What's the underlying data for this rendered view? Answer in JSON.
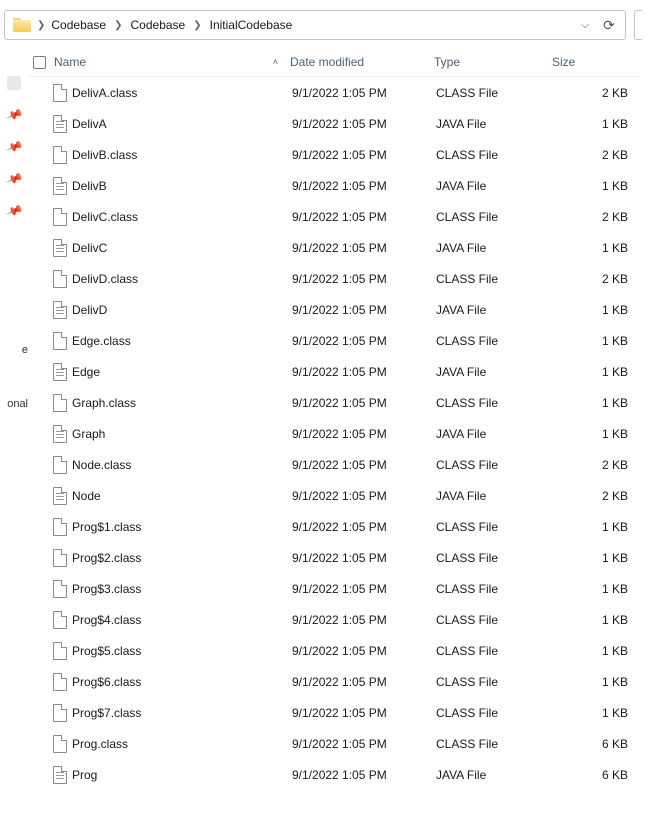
{
  "breadcrumb": {
    "items": [
      "Codebase",
      "Codebase",
      "InitialCodebase"
    ]
  },
  "columns": {
    "name": "Name",
    "date": "Date modified",
    "type": "Type",
    "size": "Size",
    "sort_indicator": "˄"
  },
  "sidebar": {
    "fragments": [
      "e",
      "onal"
    ]
  },
  "files": [
    {
      "name": "DelivA.class",
      "date": "9/1/2022 1:05 PM",
      "type": "CLASS File",
      "size": "2 KB",
      "icon": "plain"
    },
    {
      "name": "DelivA",
      "date": "9/1/2022 1:05 PM",
      "type": "JAVA File",
      "size": "1 KB",
      "icon": "text"
    },
    {
      "name": "DelivB.class",
      "date": "9/1/2022 1:05 PM",
      "type": "CLASS File",
      "size": "2 KB",
      "icon": "plain"
    },
    {
      "name": "DelivB",
      "date": "9/1/2022 1:05 PM",
      "type": "JAVA File",
      "size": "1 KB",
      "icon": "text"
    },
    {
      "name": "DelivC.class",
      "date": "9/1/2022 1:05 PM",
      "type": "CLASS File",
      "size": "2 KB",
      "icon": "plain"
    },
    {
      "name": "DelivC",
      "date": "9/1/2022 1:05 PM",
      "type": "JAVA File",
      "size": "1 KB",
      "icon": "text"
    },
    {
      "name": "DelivD.class",
      "date": "9/1/2022 1:05 PM",
      "type": "CLASS File",
      "size": "2 KB",
      "icon": "plain"
    },
    {
      "name": "DelivD",
      "date": "9/1/2022 1:05 PM",
      "type": "JAVA File",
      "size": "1 KB",
      "icon": "text"
    },
    {
      "name": "Edge.class",
      "date": "9/1/2022 1:05 PM",
      "type": "CLASS File",
      "size": "1 KB",
      "icon": "plain"
    },
    {
      "name": "Edge",
      "date": "9/1/2022 1:05 PM",
      "type": "JAVA File",
      "size": "1 KB",
      "icon": "text"
    },
    {
      "name": "Graph.class",
      "date": "9/1/2022 1:05 PM",
      "type": "CLASS File",
      "size": "1 KB",
      "icon": "plain"
    },
    {
      "name": "Graph",
      "date": "9/1/2022 1:05 PM",
      "type": "JAVA File",
      "size": "1 KB",
      "icon": "text"
    },
    {
      "name": "Node.class",
      "date": "9/1/2022 1:05 PM",
      "type": "CLASS File",
      "size": "2 KB",
      "icon": "plain"
    },
    {
      "name": "Node",
      "date": "9/1/2022 1:05 PM",
      "type": "JAVA File",
      "size": "2 KB",
      "icon": "text"
    },
    {
      "name": "Prog$1.class",
      "date": "9/1/2022 1:05 PM",
      "type": "CLASS File",
      "size": "1 KB",
      "icon": "plain"
    },
    {
      "name": "Prog$2.class",
      "date": "9/1/2022 1:05 PM",
      "type": "CLASS File",
      "size": "1 KB",
      "icon": "plain"
    },
    {
      "name": "Prog$3.class",
      "date": "9/1/2022 1:05 PM",
      "type": "CLASS File",
      "size": "1 KB",
      "icon": "plain"
    },
    {
      "name": "Prog$4.class",
      "date": "9/1/2022 1:05 PM",
      "type": "CLASS File",
      "size": "1 KB",
      "icon": "plain"
    },
    {
      "name": "Prog$5.class",
      "date": "9/1/2022 1:05 PM",
      "type": "CLASS File",
      "size": "1 KB",
      "icon": "plain"
    },
    {
      "name": "Prog$6.class",
      "date": "9/1/2022 1:05 PM",
      "type": "CLASS File",
      "size": "1 KB",
      "icon": "plain"
    },
    {
      "name": "Prog$7.class",
      "date": "9/1/2022 1:05 PM",
      "type": "CLASS File",
      "size": "1 KB",
      "icon": "plain"
    },
    {
      "name": "Prog.class",
      "date": "9/1/2022 1:05 PM",
      "type": "CLASS File",
      "size": "6 KB",
      "icon": "plain"
    },
    {
      "name": "Prog",
      "date": "9/1/2022 1:05 PM",
      "type": "JAVA File",
      "size": "6 KB",
      "icon": "text"
    }
  ]
}
